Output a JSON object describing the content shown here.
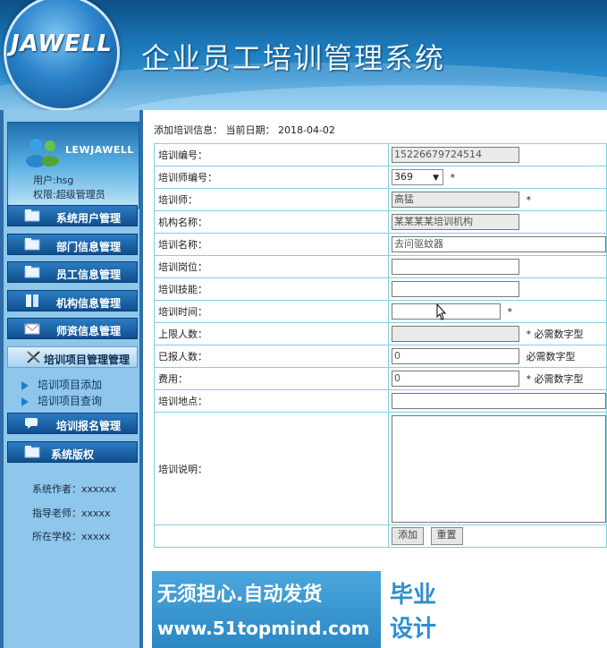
{
  "header": {
    "logo_text": "JAWELL",
    "title": "企业员工培训管理系统"
  },
  "sidebar": {
    "brand": "LEWJAWELL",
    "user_line": "用户:hsg",
    "role_line": "权限:超级管理员",
    "menu": [
      {
        "label": "系统用户管理",
        "icon": "folder-icon"
      },
      {
        "label": "部门信息管理",
        "icon": "folder-icon"
      },
      {
        "label": "员工信息管理",
        "icon": "folder-icon"
      },
      {
        "label": "机构信息管理",
        "icon": "book-icon"
      },
      {
        "label": "师资信息管理",
        "icon": "envelope-icon"
      },
      {
        "label": "培训项目管理管理",
        "icon": "tools-icon",
        "active": true
      },
      {
        "label": "培训报名管理",
        "icon": "chat-icon"
      },
      {
        "label": "系统版权",
        "icon": "folder-icon"
      }
    ],
    "submenu": [
      {
        "label": "培训项目添加"
      },
      {
        "label": "培训项目查询"
      }
    ],
    "footer": {
      "author": "系统作者：xxxxxx",
      "teacher": "指导老师：xxxxx",
      "school": "所在学校：xxxxx"
    }
  },
  "main": {
    "crumb": "添加培训信息：  当前日期：  2018-04-02",
    "form": {
      "fields": [
        {
          "label": "培训编号：",
          "value": "15226679724514"
        },
        {
          "label": "培训师编号：",
          "value": "369",
          "note": "*"
        },
        {
          "label": "培训师：",
          "value": "高猛",
          "note": "*"
        },
        {
          "label": "机构名称：",
          "value": "某某某某培训机构"
        },
        {
          "label": "培训名称：",
          "value": "去问驱蚊器"
        },
        {
          "label": "培训岗位：",
          "value": ""
        },
        {
          "label": "培训技能：",
          "value": ""
        },
        {
          "label": "培训时间：",
          "value": "",
          "note": "*"
        },
        {
          "label": "上限人数：",
          "value": "",
          "note": "* 必需数字型"
        },
        {
          "label": "已报人数：",
          "value": "0",
          "note": "必需数字型"
        },
        {
          "label": "费用：",
          "value": "0",
          "note": "* 必需数字型"
        },
        {
          "label": "培训地点：",
          "value": ""
        },
        {
          "label": "培训说明：",
          "value": ""
        }
      ],
      "submit_label": "添加",
      "reset_label": "重置"
    },
    "banner": {
      "line1": "无须担心.自动发货",
      "line2": "www.51topmind.com",
      "box_top": "毕业",
      "box_bottom": "设计"
    }
  },
  "colors": {
    "header_blue": "#1c78b8",
    "sidebar_bg": "#8ec6ec",
    "menu_blue": "#0f4f8f",
    "table_border": "#7fd0e0",
    "banner_blue": "#2c88c4"
  }
}
